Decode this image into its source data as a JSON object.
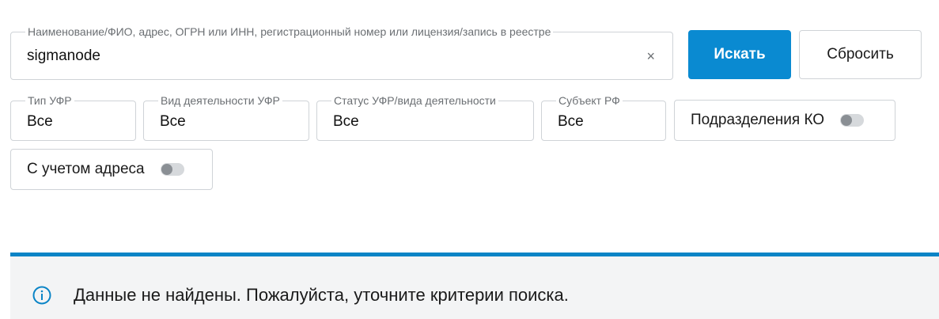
{
  "search": {
    "legend": "Наименование/ФИО, адрес, ОГРН или ИНН, регистрационный номер или лицензия/запись в реестре",
    "value": "sigmanode",
    "clear_icon": "×"
  },
  "buttons": {
    "search_label": "Искать",
    "reset_label": "Сбросить"
  },
  "filters": {
    "type": {
      "legend": "Тип УФР",
      "value": "Все"
    },
    "activity": {
      "legend": "Вид деятельности УФР",
      "value": "Все"
    },
    "status": {
      "legend": "Статус УФР/вида деятельности",
      "value": "Все"
    },
    "region": {
      "legend": "Субъект РФ",
      "value": "Все"
    }
  },
  "toggles": {
    "divisions": {
      "label": "Подразделения КО",
      "on": false
    },
    "address": {
      "label": "С учетом адреса",
      "on": false
    }
  },
  "alert": {
    "icon": "info-icon",
    "message": "Данные не найдены. Пожалуйста, уточните критерии поиска."
  },
  "colors": {
    "accent": "#0a8ad1",
    "alert_border": "#0a84c6",
    "alert_bg": "#f3f4f5",
    "border": "#cfd3d7"
  }
}
